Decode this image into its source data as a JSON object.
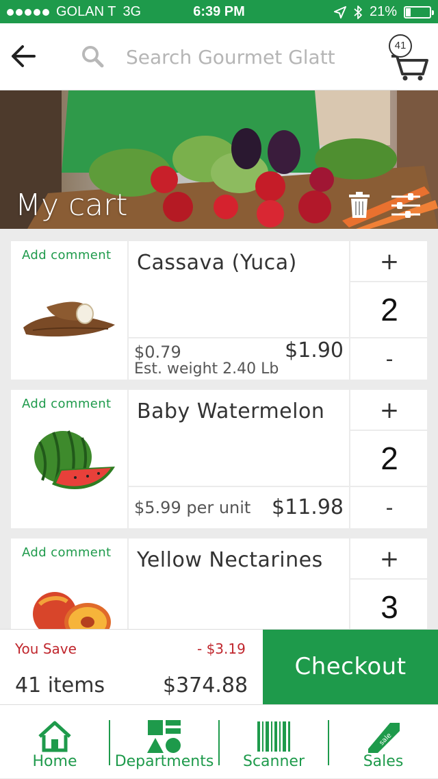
{
  "status_bar": {
    "carrier": "GOLAN T",
    "network": "3G",
    "time": "6:39 PM",
    "battery": "21%",
    "battery_level": 0.21
  },
  "header": {
    "back_icon": "arrow-left-icon",
    "search_placeholder": "Search Gourmet Glatt",
    "cart_count": "41"
  },
  "banner": {
    "title": "My cart",
    "trash_icon": "trash-icon",
    "filter_icon": "sliders-icon"
  },
  "items": [
    {
      "comment_label": "Add comment",
      "name": "Cassava (Yuca)",
      "unit_price": "$0.79",
      "est_weight": "Est. weight 2.40 Lb",
      "line_total": "$1.90",
      "quantity": "2",
      "plus": "+",
      "minus": "-"
    },
    {
      "comment_label": "Add comment",
      "name": "Baby Watermelon",
      "unit_price": "$5.99 per unit",
      "line_total": "$11.98",
      "quantity": "2",
      "plus": "+",
      "minus": "-"
    },
    {
      "comment_label": "Add comment",
      "name": "Yellow Nectarines",
      "quantity": "3",
      "plus": "+"
    }
  ],
  "summary": {
    "you_save_label": "You Save",
    "you_save_amount": "- $3.19",
    "item_count": "41 items",
    "total": "$374.88",
    "checkout_label": "Checkout"
  },
  "tabs": [
    {
      "label": "Home",
      "icon": "home-icon"
    },
    {
      "label": "Departments",
      "icon": "shapes-icon"
    },
    {
      "label": "Scanner",
      "icon": "barcode-icon"
    },
    {
      "label": "Sales",
      "icon": "sale-tag-icon"
    }
  ],
  "colors": {
    "brand_green": "#1e9a4b",
    "save_red": "#c0262d"
  }
}
